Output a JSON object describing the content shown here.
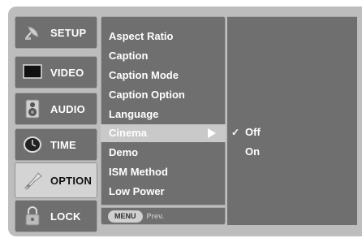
{
  "sidebar": {
    "tabs": [
      {
        "label": "SETUP",
        "icon": "satellite-dish-icon",
        "active": false
      },
      {
        "label": "VIDEO",
        "icon": "tv-screen-icon",
        "active": false
      },
      {
        "label": "AUDIO",
        "icon": "speaker-icon",
        "active": false
      },
      {
        "label": "TIME",
        "icon": "clock-icon",
        "active": false
      },
      {
        "label": "OPTION",
        "icon": "tag-icon",
        "active": true
      },
      {
        "label": "LOCK",
        "icon": "padlock-icon",
        "active": false
      }
    ]
  },
  "menu": {
    "items": [
      {
        "label": "Aspect Ratio"
      },
      {
        "label": "Caption"
      },
      {
        "label": "Caption Mode"
      },
      {
        "label": "Caption Option"
      },
      {
        "label": "Language"
      },
      {
        "label": "Cinema",
        "selected": true
      },
      {
        "label": "Demo"
      },
      {
        "label": "ISM Method"
      },
      {
        "label": "Low Power"
      }
    ]
  },
  "footer": {
    "button_label": "MENU",
    "hint": "Prev."
  },
  "submenu": {
    "options": [
      {
        "label": "Off",
        "checked": true
      },
      {
        "label": "On",
        "checked": false
      }
    ],
    "check_glyph": "✓"
  },
  "colors": {
    "panel": "#6f6f6f",
    "frame": "#bdbdbd",
    "highlight": "#c9c9c9"
  }
}
